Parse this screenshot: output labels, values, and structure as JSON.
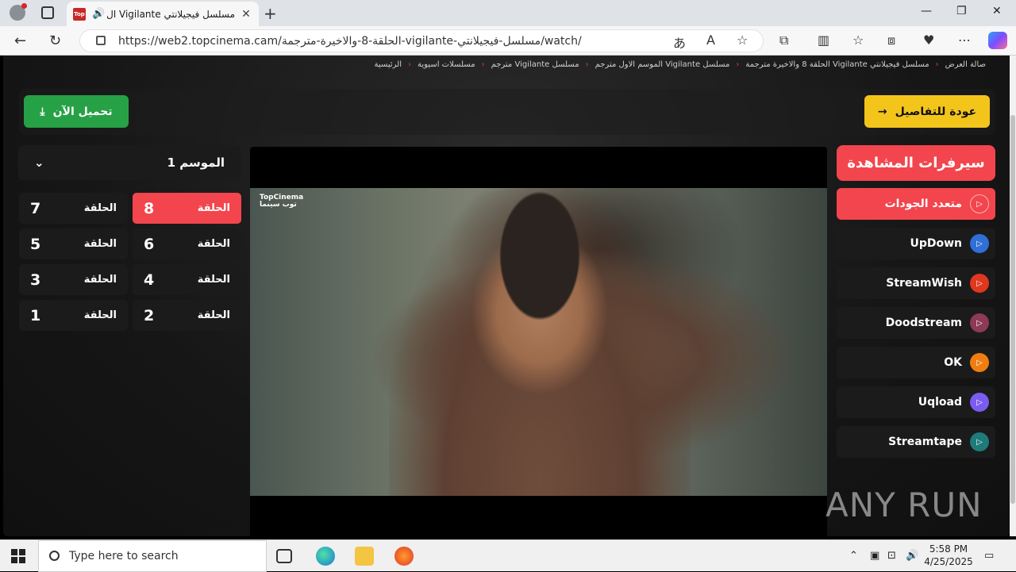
{
  "browser": {
    "tab_title": "مسلسل فيجيلانتي Vigilante ال",
    "url": "https://web2.topcinema.cam/الحلقة-8-والاخيرة-مترجمة-vigilante-مسلسل-فيجيلانتي/watch/",
    "favicon_text": "Top"
  },
  "breadcrumb": [
    "الرئيسية",
    "مسلسلات اسيوية",
    "مسلسل Vigilante مترجم",
    "مسلسل Vigilante الموسم الاول مترجم",
    "مسلسل فيجيلانتي Vigilante الحلقة 8 والاخيرة مترجمة",
    "صالة العرض"
  ],
  "actions": {
    "download_label": "تحميل الآن",
    "back_label": "عودة للتفاصيل"
  },
  "season": {
    "label": "الموسم 1"
  },
  "episodes": [
    {
      "label": "الحلقة",
      "num": "8",
      "active": true
    },
    {
      "label": "الحلقة",
      "num": "7",
      "active": false
    },
    {
      "label": "الحلقة",
      "num": "6",
      "active": false
    },
    {
      "label": "الحلقة",
      "num": "5",
      "active": false
    },
    {
      "label": "الحلقة",
      "num": "4",
      "active": false
    },
    {
      "label": "الحلقة",
      "num": "3",
      "active": false
    },
    {
      "label": "الحلقة",
      "num": "2",
      "active": false
    },
    {
      "label": "الحلقة",
      "num": "1",
      "active": false
    }
  ],
  "player": {
    "watermark_line1": "TopCinema",
    "watermark_line2": "توب سينما"
  },
  "servers": {
    "title": "سيرفرات المشاهدة",
    "items": [
      {
        "name": "متعدد الجودات",
        "active": true,
        "icon_color": "#f2454d"
      },
      {
        "name": "UpDown",
        "active": false,
        "icon_color": "#2f6fd6"
      },
      {
        "name": "StreamWish",
        "active": false,
        "icon_color": "#e0371f"
      },
      {
        "name": "Doodstream",
        "active": false,
        "icon_color": "#8c3a55"
      },
      {
        "name": "OK",
        "active": false,
        "icon_color": "#f07d10"
      },
      {
        "name": "Uqload",
        "active": false,
        "icon_color": "#7b5cf0"
      },
      {
        "name": "Streamtape",
        "active": false,
        "icon_color": "#1f7a7a"
      }
    ]
  },
  "watermark": "ANY RUN",
  "taskbar": {
    "search_placeholder": "Type here to search",
    "time": "5:58 PM",
    "date": "4/25/2025"
  }
}
